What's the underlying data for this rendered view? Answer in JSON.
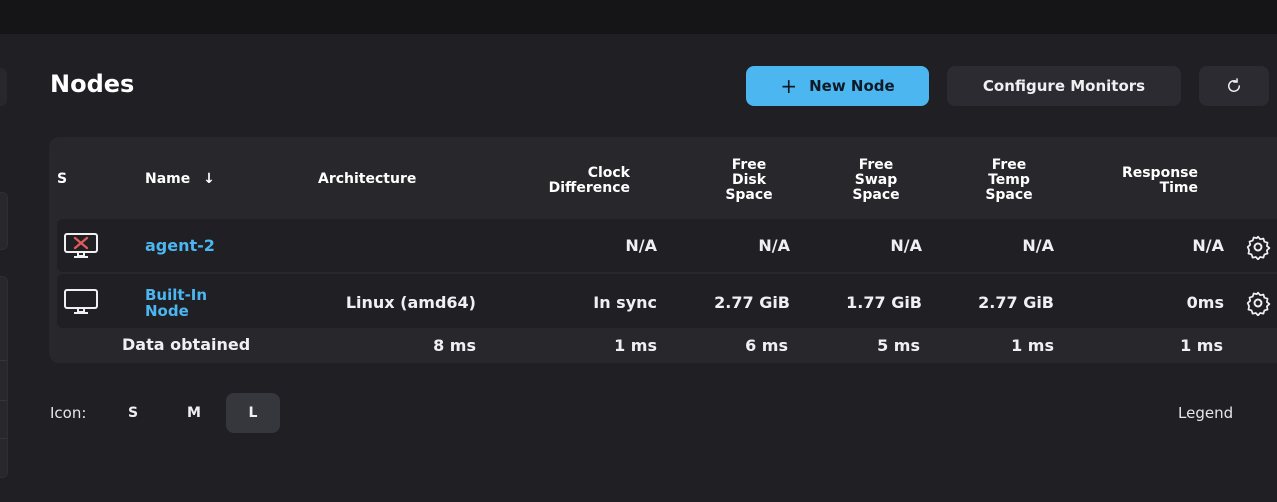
{
  "page": {
    "title": "Nodes"
  },
  "toolbar": {
    "new_node_icon": "+",
    "new_node_label": "New Node",
    "configure_label": "Configure Monitors",
    "refresh_icon": "refresh-icon"
  },
  "colors": {
    "accent": "#4cb6f0",
    "background": "#1f1f24",
    "card": "#27272c",
    "offline_icon": "#e05a5a"
  },
  "table": {
    "headers": {
      "s": "S",
      "name": "Name",
      "sort_indicator": "↓",
      "architecture": "Architecture",
      "clock": [
        "Clock",
        "Difference"
      ],
      "disk": [
        "Free",
        "Disk",
        "Space"
      ],
      "swap": [
        "Free",
        "Swap",
        "Space"
      ],
      "temp": [
        "Free",
        "Temp",
        "Space"
      ],
      "response": [
        "Response",
        "Time"
      ]
    },
    "rows": [
      {
        "status_icon": "computer-offline-icon",
        "name": "agent-2",
        "architecture": "",
        "clock": "N/A",
        "disk": "N/A",
        "swap": "N/A",
        "temp": "N/A",
        "response": "N/A"
      },
      {
        "status_icon": "computer-icon",
        "name_lines": [
          "Built-In",
          "Node"
        ],
        "architecture": "Linux (amd64)",
        "clock": "In sync",
        "disk": "2.77 GiB",
        "swap": "1.77 GiB",
        "temp": "2.77 GiB",
        "response": "0ms"
      }
    ],
    "footer": {
      "label": "Data obtained",
      "architecture": "8 ms",
      "clock": "1 ms",
      "disk": "6 ms",
      "swap": "5 ms",
      "temp": "1 ms",
      "response": "1 ms"
    }
  },
  "icon_size": {
    "label": "Icon:",
    "options": [
      "S",
      "M",
      "L"
    ],
    "selected": "L"
  },
  "legend_label": "Legend"
}
